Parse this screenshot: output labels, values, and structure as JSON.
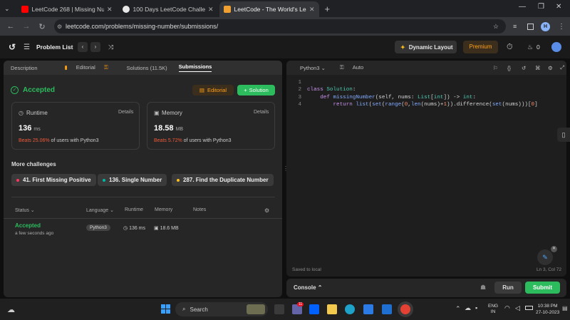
{
  "browser": {
    "tabs": [
      {
        "title": "LeetCode 268 | Missing Numb",
        "color": "#ff0000"
      },
      {
        "title": "100 Days LeetCode Challenge",
        "color": "#e8e8e8"
      },
      {
        "title": "LeetCode - The World's Leadi",
        "color": "#f0a030"
      }
    ],
    "url": "leetcode.com/problems/missing-number/submissions/",
    "profile": "H"
  },
  "lc": {
    "problem_list": "Problem List",
    "dynamic_layout": "Dynamic Layout",
    "premium": "Premium",
    "fire_count": "0"
  },
  "left": {
    "tabs": [
      "Description",
      "Editorial",
      "Solutions (11.5K)",
      "Submissions"
    ],
    "status": "Accepted",
    "editorial_btn": "Editorial",
    "solution_btn": "Solution",
    "runtime": {
      "label": "Runtime",
      "details": "Details",
      "value": "136",
      "unit": "ms",
      "beats": "Beats 25.06%",
      "suffix": "of users with Python3"
    },
    "memory": {
      "label": "Memory",
      "details": "Details",
      "value": "18.58",
      "unit": "MB",
      "beats": "Beats 5.72%",
      "suffix": "of users with Python3"
    },
    "more": "More challenges",
    "challenges": [
      {
        "label": "41. First Missing Positive",
        "color": "#ff375f"
      },
      {
        "label": "136. Single Number",
        "color": "#00b8a3"
      },
      {
        "label": "287. Find the Duplicate Number",
        "color": "#ffc01e"
      }
    ],
    "table": {
      "headers": [
        "Status",
        "Language",
        "Runtime",
        "Memory",
        "Notes"
      ],
      "row": {
        "status": "Accepted",
        "time": "a few seconds ago",
        "lang": "Python3",
        "runtime": "136 ms",
        "memory": "18.6 MB"
      }
    }
  },
  "editor": {
    "lang": "Python3",
    "auto": "Auto",
    "lines": [
      "1",
      "2",
      "3",
      "4"
    ],
    "saved": "Saved to local",
    "pos": "Ln 3, Col 72",
    "console": "Console",
    "run": "Run",
    "submit": "Submit"
  },
  "taskbar": {
    "search": "Search",
    "lang1": "ENG",
    "lang2": "IN",
    "time": "10:38 PM",
    "date": "27-10-2023",
    "badge": "11"
  }
}
